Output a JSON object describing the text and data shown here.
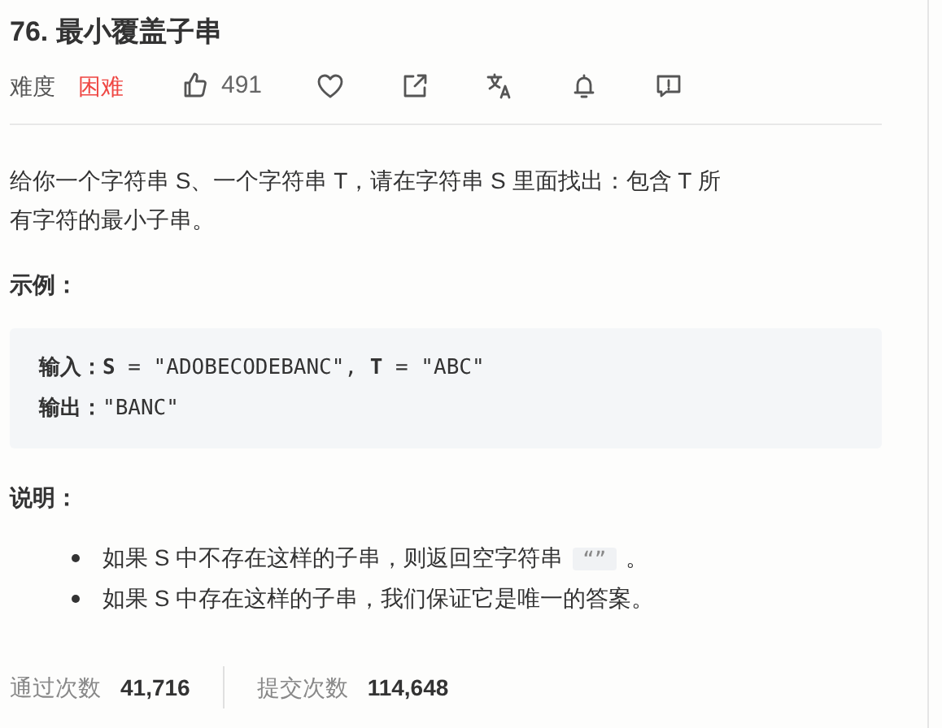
{
  "title": "76. 最小覆盖子串",
  "meta": {
    "difficulty_label": "难度",
    "difficulty": "困难",
    "likes": "491"
  },
  "description": "给你一个字符串 S、一个字符串 T，请在字符串 S 里面找出：包含 T 所有字符的最小子串。",
  "example_heading": "示例：",
  "example_lines": [
    {
      "label": "输入：",
      "value": "**S** = \"ADOBECODEBANC\", **T** = \"ABC\""
    },
    {
      "label": "输出：",
      "value": "\"BANC\""
    }
  ],
  "notes_heading": "说明：",
  "notes": [
    {
      "text": "如果 S 中不存在这样的子串，则返回空字符串",
      "code": "“”",
      "after": "。"
    },
    {
      "text": "如果 S 中存在这样的子串，我们保证它是唯一的答案。"
    }
  ],
  "stats": [
    {
      "label": "通过次数",
      "value": "41,716"
    },
    {
      "label": "提交次数",
      "value": "114,648"
    }
  ]
}
